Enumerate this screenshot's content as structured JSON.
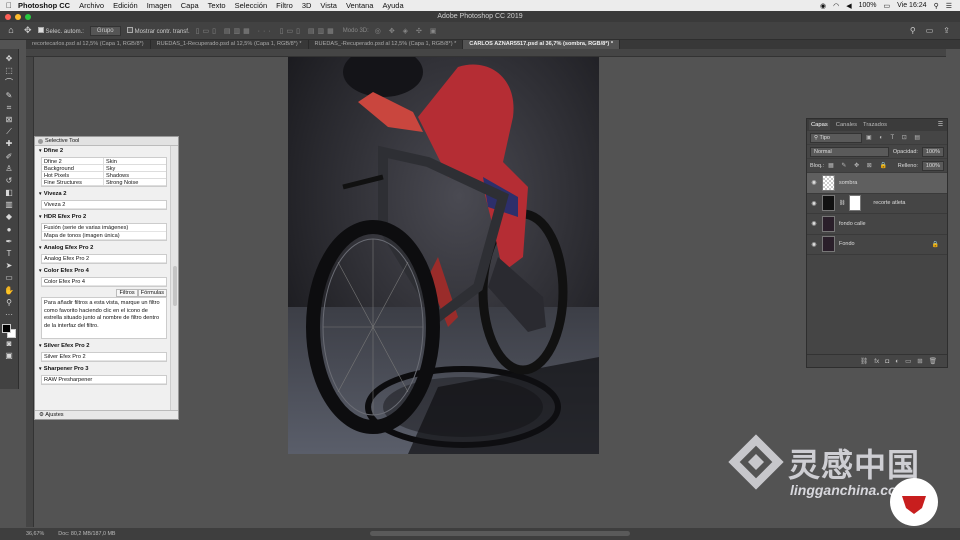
{
  "menubar": {
    "app": "Photoshop CC",
    "items": [
      "Archivo",
      "Edición",
      "Imagen",
      "Capa",
      "Texto",
      "Selección",
      "Filtro",
      "3D",
      "Vista",
      "Ventana",
      "Ayuda"
    ],
    "battery": "100%",
    "clock": "Vie 16:24"
  },
  "window": {
    "title": "Adobe Photoshop CC 2019"
  },
  "options": {
    "autoselect_label": "Selec. autom.:",
    "autoselect_value": "Grupo",
    "transform_label": "Mostrar contr. transf.",
    "mode3d_label": "Modo 3D:"
  },
  "tabs": [
    "recortecarlos.psd al 12,5% (Capa 1, RGB/8*)",
    "RUEDAS_1-Recuperado.psd al 12,5% (Capa 1, RGB/8*) *",
    "RUEDAS_-Recuperado.psd al 12,5% (Capa 1, RGB/8*) *",
    "CARLOS AZNAR5517.psd al 36,7% (sombra, RGB/8*) *"
  ],
  "selective_tool": {
    "title": "Selective Tool",
    "dfine": {
      "heading": "Dfine 2",
      "items": [
        "Dfine 2",
        "Skin",
        "Background",
        "Sky",
        "Hot Pixels",
        "Shadows",
        "Fine Structures",
        "Strong Noise"
      ]
    },
    "viveza": {
      "heading": "Viveza 2",
      "items": [
        "Viveza 2"
      ]
    },
    "hdr": {
      "heading": "HDR Efex Pro 2",
      "items": [
        "Fusión (serie de varias imágenes)",
        "Mapa de tonos (imagen única)"
      ]
    },
    "analog": {
      "heading": "Analog Efex Pro 2",
      "items": [
        "Analog Efex Pro 2"
      ]
    },
    "color": {
      "heading": "Color Efex Pro 4",
      "items": [
        "Color Efex Pro 4"
      ],
      "tab1": "Filtros",
      "tab2": "Fórmulas",
      "desc": "Para añadir filtros a esta vista, marque un filtro como favorito haciendo clic en el icono de estrella situado junto al nombre de filtro dentro de la interfaz del filtro."
    },
    "silver": {
      "heading": "Silver Efex Pro 2",
      "items": [
        "Silver Efex Pro 2"
      ]
    },
    "sharpener": {
      "heading": "Sharpener Pro 3",
      "items": [
        "RAW Presharpener"
      ]
    },
    "footer": "Ajustes"
  },
  "layers": {
    "tabs": [
      "Capas",
      "Canales",
      "Trazados"
    ],
    "filter": "Tipo",
    "blend": "Normal",
    "opacity_label": "Opacidad:",
    "opacity": "100%",
    "lock_label": "Bloq.:",
    "fill_label": "Relleno:",
    "fill": "100%",
    "items": [
      {
        "name": "sombra",
        "selected": true
      },
      {
        "name": "recorte atleta",
        "selected": false
      },
      {
        "name": "fondo calle",
        "selected": false
      },
      {
        "name": "Fondo",
        "selected": false
      }
    ]
  },
  "status": {
    "zoom": "36,67%",
    "doc": "Doc: 80,2 MB/187,0 MB"
  },
  "watermark": {
    "title": "灵感中国",
    "subtitle": "lingganchina.com"
  },
  "colors": {
    "accent_red": "#c81e1e",
    "panel": "#454545",
    "workspace": "#535353"
  }
}
